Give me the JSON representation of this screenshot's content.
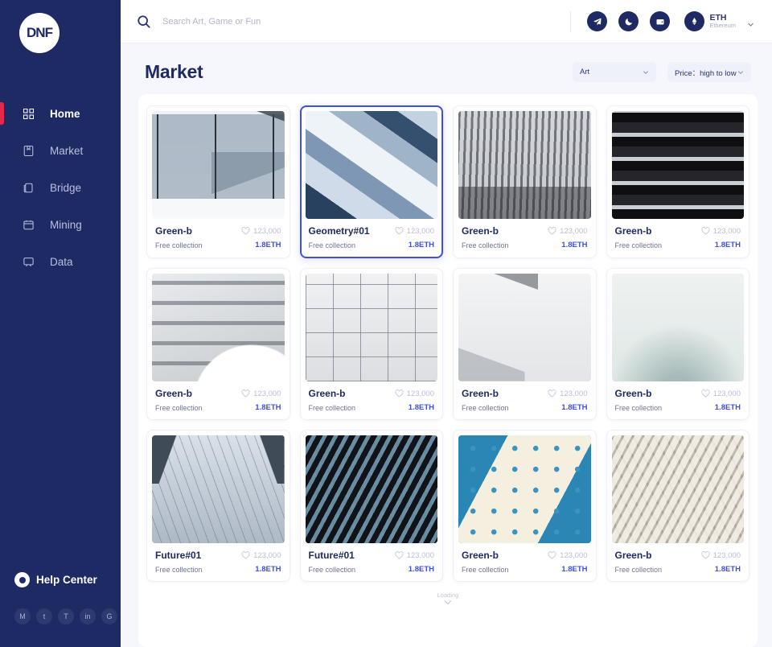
{
  "sidebar": {
    "logo_text": "DNF",
    "items": [
      {
        "label": "Home",
        "icon": "grid-icon",
        "active": true
      },
      {
        "label": "Market",
        "icon": "store-icon",
        "active": false
      },
      {
        "label": "Bridge",
        "icon": "bridge-icon",
        "active": false
      },
      {
        "label": "Mining",
        "icon": "calendar-icon",
        "active": false
      },
      {
        "label": "Data",
        "icon": "chart-icon",
        "active": false
      }
    ],
    "help_label": "Help Center",
    "social": [
      {
        "name": "medium-icon",
        "glyph": "M"
      },
      {
        "name": "twitter-icon",
        "glyph": "t"
      },
      {
        "name": "telegram-icon",
        "glyph": "T"
      },
      {
        "name": "linkedin-icon",
        "glyph": "in"
      },
      {
        "name": "github-icon",
        "glyph": "G"
      }
    ],
    "active_indicator_color": "#e8274b",
    "background_color": "#1e2a63"
  },
  "topbar": {
    "search_placeholder": "Search Art, Game or Fun",
    "search_value": "",
    "icons": [
      {
        "name": "telegram-icon"
      },
      {
        "name": "moon-icon"
      },
      {
        "name": "wallet-icon"
      }
    ],
    "chain": {
      "symbol": "ETH",
      "name": "Ethereum"
    }
  },
  "page": {
    "title": "Market",
    "filters": [
      {
        "name": "category-select",
        "value": "Art"
      },
      {
        "name": "sort-select",
        "value": "Price：high to low"
      }
    ],
    "loading_label": "Loading",
    "accent_color": "#3f4fe0",
    "title_color": "#1e2a63"
  },
  "cards": [
    {
      "title": "Green-b",
      "likes": "123,000",
      "collection": "Free collection",
      "price": "1.8ETH",
      "art": "t1",
      "selected": false
    },
    {
      "title": "Geometry#01",
      "likes": "123,000",
      "collection": "Free collection",
      "price": "1.8ETH",
      "art": "t2",
      "selected": true
    },
    {
      "title": "Green-b",
      "likes": "123,000",
      "collection": "Free collection",
      "price": "1.8ETH",
      "art": "t3",
      "selected": false
    },
    {
      "title": "Green-b",
      "likes": "123,000",
      "collection": "Free collection",
      "price": "1.8ETH",
      "art": "t4",
      "selected": false
    },
    {
      "title": "Green-b",
      "likes": "123,000",
      "collection": "Free collection",
      "price": "1.8ETH",
      "art": "t5",
      "selected": false
    },
    {
      "title": "Green-b",
      "likes": "123,000",
      "collection": "Free collection",
      "price": "1.8ETH",
      "art": "t6",
      "selected": false
    },
    {
      "title": "Green-b",
      "likes": "123,000",
      "collection": "Free collection",
      "price": "1.8ETH",
      "art": "t7",
      "selected": false
    },
    {
      "title": "Green-b",
      "likes": "123,000",
      "collection": "Free collection",
      "price": "1.8ETH",
      "art": "t8",
      "selected": false
    },
    {
      "title": "Future#01",
      "likes": "123,000",
      "collection": "Free collection",
      "price": "1.8ETH",
      "art": "t9",
      "selected": false
    },
    {
      "title": "Future#01",
      "likes": "123,000",
      "collection": "Free collection",
      "price": "1.8ETH",
      "art": "t10",
      "selected": false
    },
    {
      "title": "Green-b",
      "likes": "123,000",
      "collection": "Free collection",
      "price": "1.8ETH",
      "art": "t11",
      "selected": false
    },
    {
      "title": "Green-b",
      "likes": "123,000",
      "collection": "Free collection",
      "price": "1.8ETH",
      "art": "t12",
      "selected": false
    }
  ]
}
